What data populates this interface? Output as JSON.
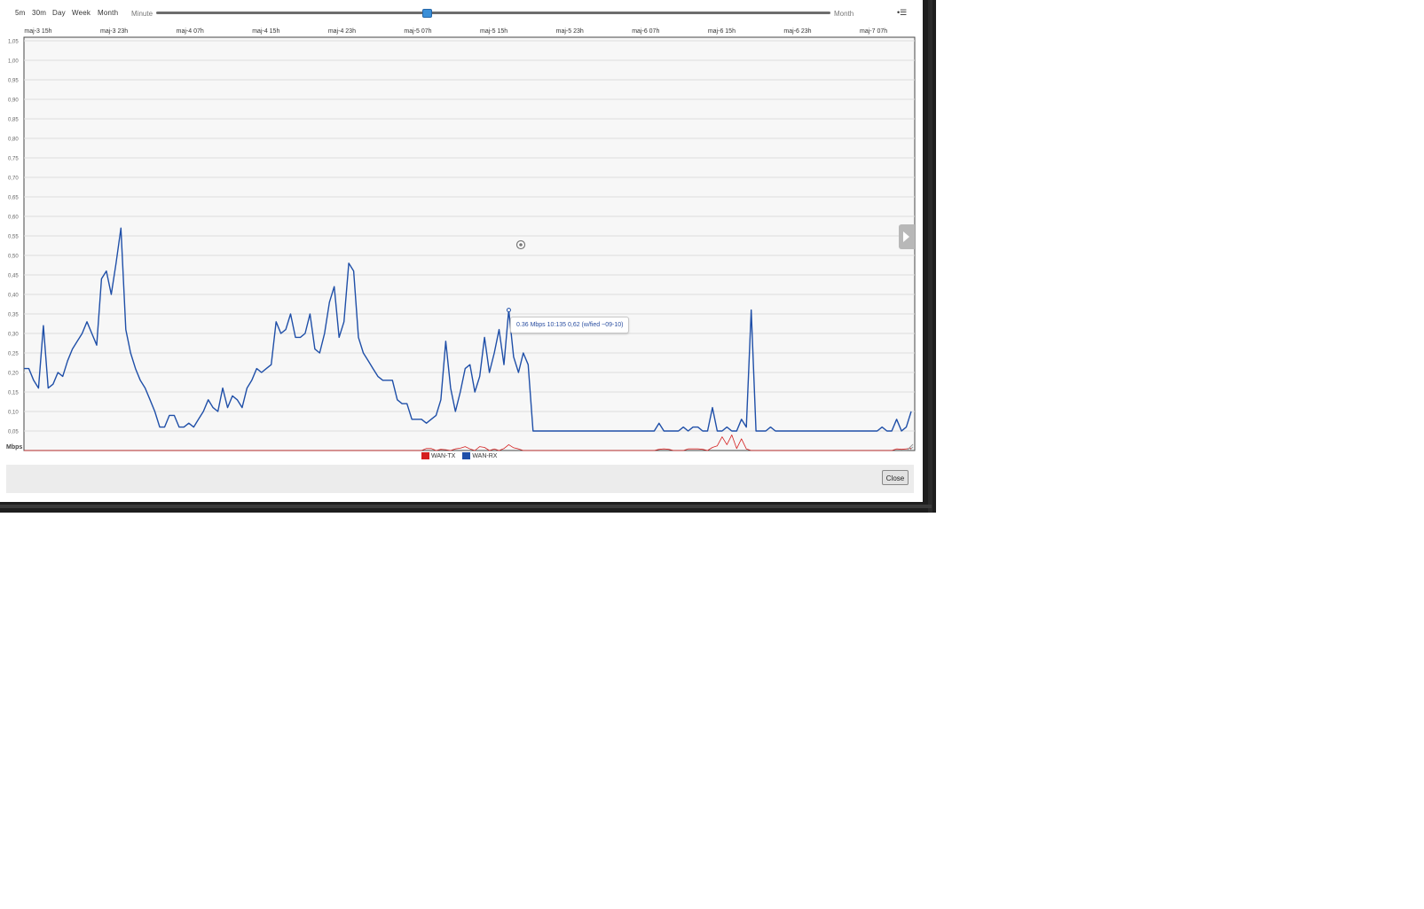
{
  "toolbar": {
    "range_buttons": [
      "5m",
      "30m",
      "Day",
      "Week",
      "Month"
    ],
    "slider_min_label": "Minute",
    "slider_max_label": "Month",
    "slider_value": 0.4,
    "menu_icon": "menu-icon"
  },
  "chart_data": {
    "type": "line",
    "ylabel": "Mbps",
    "ylim": [
      0,
      1.05
    ],
    "y_ticks": [
      "0,05",
      "0,10",
      "0,15",
      "0,20",
      "0,25",
      "0,30",
      "0,35",
      "0,40",
      "0,45",
      "0,50",
      "0,55",
      "0,60",
      "0,65",
      "0,70",
      "0,75",
      "0,80",
      "0,85",
      "0,90",
      "0,95",
      "1,00",
      "1,05"
    ],
    "x_ticks": [
      "maj-3 15h",
      "maj-3 23h",
      "maj-4 07h",
      "maj-4 15h",
      "maj-4 23h",
      "maj-5 07h",
      "maj-5 15h",
      "maj-5 23h",
      "maj-6 07h",
      "maj-6 15h",
      "maj-6 23h",
      "maj-7 07h"
    ],
    "grid": true,
    "legend_position": "bottom-center",
    "series": [
      {
        "name": "WAN-TX",
        "color": "#d42020",
        "values": [
          0,
          0,
          0,
          0,
          0,
          0,
          0,
          0,
          0,
          0,
          0,
          0,
          0,
          0,
          0,
          0,
          0,
          0,
          0,
          0,
          0,
          0,
          0,
          0,
          0,
          0,
          0,
          0,
          0,
          0,
          0,
          0,
          0,
          0,
          0,
          0,
          0,
          0,
          0,
          0,
          0,
          0,
          0,
          0,
          0,
          0,
          0,
          0,
          0,
          0,
          0,
          0,
          0,
          0,
          0,
          0,
          0,
          0,
          0,
          0,
          0,
          0,
          0,
          0,
          0,
          0,
          0,
          0,
          0,
          0,
          0,
          0,
          0,
          0,
          0,
          0,
          0,
          0,
          0,
          0,
          0,
          0,
          0,
          0.005,
          0.005,
          0,
          0.003,
          0.002,
          0,
          0.004,
          0.006,
          0.01,
          0.004,
          0,
          0.01,
          0.008,
          0,
          0.004,
          0,
          0.005,
          0.015,
          0.007,
          0.004,
          0,
          0,
          0,
          0,
          0,
          0,
          0,
          0,
          0,
          0,
          0,
          0,
          0,
          0,
          0,
          0,
          0,
          0,
          0,
          0,
          0,
          0,
          0,
          0,
          0,
          0,
          0,
          0,
          0.003,
          0.004,
          0.003,
          0,
          0,
          0,
          0.004,
          0.004,
          0.004,
          0.003,
          0,
          0.008,
          0.012,
          0.035,
          0.015,
          0.04,
          0.005,
          0.03,
          0.004,
          0,
          0,
          0,
          0,
          0,
          0,
          0,
          0,
          0,
          0,
          0,
          0,
          0,
          0,
          0,
          0,
          0,
          0,
          0,
          0,
          0,
          0,
          0,
          0,
          0,
          0,
          0,
          0,
          0,
          0,
          0.004,
          0.003,
          0.004,
          0.006
        ]
      },
      {
        "name": "WAN-RX",
        "color": "#1f4fa8",
        "values": [
          0.21,
          0.21,
          0.18,
          0.16,
          0.32,
          0.16,
          0.17,
          0.2,
          0.19,
          0.23,
          0.26,
          0.28,
          0.3,
          0.33,
          0.3,
          0.27,
          0.44,
          0.46,
          0.4,
          0.48,
          0.57,
          0.31,
          0.25,
          0.21,
          0.18,
          0.16,
          0.13,
          0.1,
          0.06,
          0.06,
          0.09,
          0.09,
          0.06,
          0.06,
          0.07,
          0.06,
          0.08,
          0.1,
          0.13,
          0.11,
          0.1,
          0.16,
          0.11,
          0.14,
          0.13,
          0.11,
          0.16,
          0.18,
          0.21,
          0.2,
          0.21,
          0.22,
          0.33,
          0.3,
          0.31,
          0.35,
          0.29,
          0.29,
          0.3,
          0.35,
          0.26,
          0.25,
          0.3,
          0.38,
          0.42,
          0.29,
          0.33,
          0.48,
          0.46,
          0.29,
          0.25,
          0.23,
          0.21,
          0.19,
          0.18,
          0.18,
          0.18,
          0.13,
          0.12,
          0.12,
          0.08,
          0.08,
          0.08,
          0.07,
          0.08,
          0.09,
          0.13,
          0.28,
          0.16,
          0.1,
          0.15,
          0.21,
          0.22,
          0.15,
          0.19,
          0.29,
          0.2,
          0.25,
          0.31,
          0.22,
          0.36,
          0.24,
          0.2,
          0.25,
          0.22,
          0.05,
          0.05,
          0.05,
          0.05,
          0.05,
          0.05,
          0.05,
          0.05,
          0.05,
          0.05,
          0.05,
          0.05,
          0.05,
          0.05,
          0.05,
          0.05,
          0.05,
          0.05,
          0.05,
          0.05,
          0.05,
          0.05,
          0.05,
          0.05,
          0.05,
          0.05,
          0.07,
          0.05,
          0.05,
          0.05,
          0.05,
          0.06,
          0.05,
          0.06,
          0.06,
          0.05,
          0.05,
          0.11,
          0.05,
          0.05,
          0.06,
          0.05,
          0.05,
          0.08,
          0.06,
          0.36,
          0.05,
          0.05,
          0.05,
          0.06,
          0.05,
          0.05,
          0.05,
          0.05,
          0.05,
          0.05,
          0.05,
          0.05,
          0.05,
          0.05,
          0.05,
          0.05,
          0.05,
          0.05,
          0.05,
          0.05,
          0.05,
          0.05,
          0.05,
          0.05,
          0.05,
          0.05,
          0.06,
          0.05,
          0.05,
          0.08,
          0.05,
          0.06,
          0.1
        ]
      }
    ]
  },
  "tooltip": {
    "text": "0.36 Mbps 10:135 0,62 (w/fied ~09-10)",
    "point_index": 100,
    "series": "WAN-RX"
  },
  "footer": {
    "close_label": "Close"
  },
  "colors": {
    "rx_line": "#1f4fa8",
    "tx_line": "#d42020",
    "slider_handle": "#3a8fd8"
  }
}
